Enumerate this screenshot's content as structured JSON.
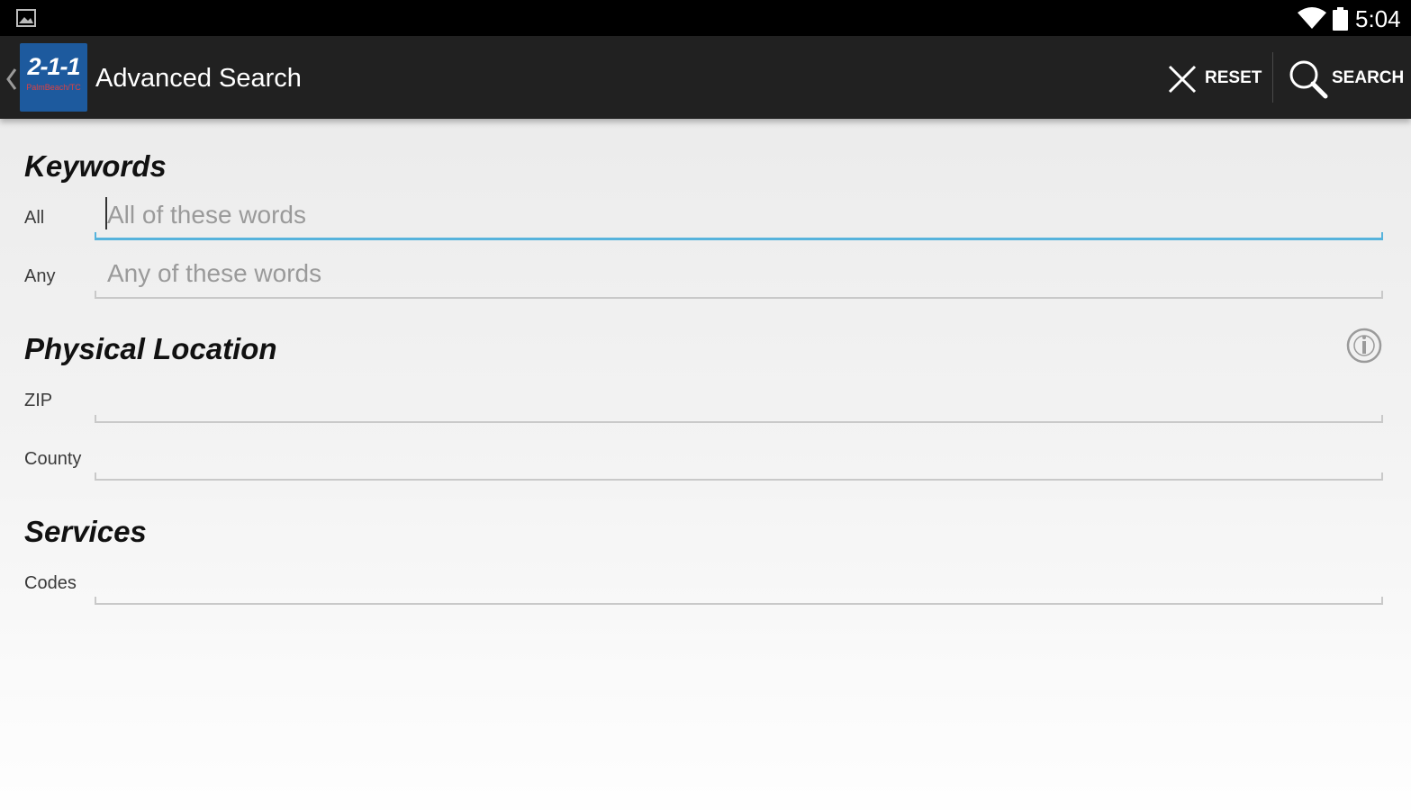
{
  "status_bar": {
    "time": "5:04",
    "icons": [
      "picture-icon",
      "wifi-icon",
      "battery-icon"
    ]
  },
  "action_bar": {
    "title": "Advanced Search",
    "logo": {
      "number": "2-1-1",
      "sub": "PalmBeach/TC"
    },
    "reset_label": "RESET",
    "search_label": "SEARCH",
    "icons": [
      "back-chevron-icon",
      "close-icon",
      "search-icon"
    ]
  },
  "keywords": {
    "title": "Keywords",
    "all": {
      "label": "All",
      "value": "",
      "placeholder": "All of these words"
    },
    "any": {
      "label": "Any",
      "value": "",
      "placeholder": "Any of these words"
    }
  },
  "physical_location": {
    "title": "Physical Location",
    "zip": {
      "label": "ZIP",
      "value": "",
      "placeholder": ""
    },
    "county": {
      "label": "County",
      "value": "",
      "placeholder": ""
    },
    "info_icon": "info-icon"
  },
  "services": {
    "title": "Services",
    "codes": {
      "label": "Codes",
      "value": "",
      "placeholder": ""
    }
  },
  "colors": {
    "status_bar_bg": "#000000",
    "action_bar_bg": "#212121",
    "logo_bg": "#1d5a9e",
    "focus_underline": "#56b3dc",
    "idle_underline": "#c9c9c9"
  }
}
